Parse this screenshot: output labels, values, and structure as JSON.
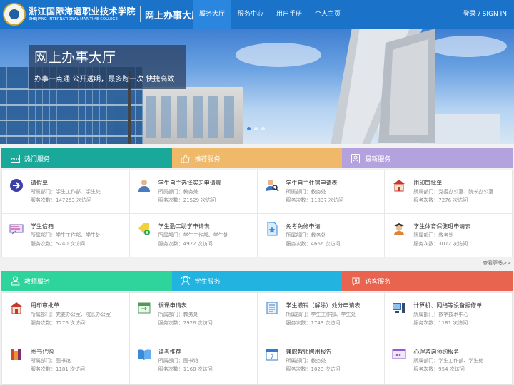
{
  "header": {
    "school_cn": "浙江国际海运职业技术学院",
    "school_en": "ZHEJIANG INTERNATIONAL MARITIME COLLEGE",
    "portal_title": "网上办事大厅",
    "nav": [
      "服务大厅",
      "服务中心",
      "用户手册",
      "个人主页"
    ],
    "login": "登录 / SIGN IN"
  },
  "banner": {
    "title": "网上办事大厅",
    "subtitle": "办事一点通 公开透明，最多跑一次 快捷高效",
    "slides": 3,
    "active_slide": 1
  },
  "section1": {
    "tabs": [
      {
        "label": "热门服务",
        "color": "#1aa89a",
        "icon": "hot-icon"
      },
      {
        "label": "推荐服务",
        "color": "#f0b96a",
        "icon": "thumb-up-icon"
      },
      {
        "label": "最新服务",
        "color": "#b4a2df",
        "icon": "new-badge-icon"
      }
    ],
    "cards": [
      {
        "title": "请假单",
        "dept": "所属部门：学生工作部、学生处",
        "count": "服务次数：147253 次访问",
        "icon": "arrow-circle-icon"
      },
      {
        "title": "学生自主选择实习申请表",
        "dept": "所属部门：教务处",
        "count": "服务次数：21529 次访问",
        "icon": "person-icon"
      },
      {
        "title": "学生自主住宿申请表",
        "dept": "所属部门：教务处",
        "count": "服务次数：11837 次访问",
        "icon": "person-search-icon"
      },
      {
        "title": "用印审批单",
        "dept": "所属部门：党委办公室、院长办公室",
        "count": "服务次数：7276 次访问",
        "icon": "building-icon"
      },
      {
        "title": "学生信箱",
        "dept": "所属部门：学生工作部、学生处",
        "count": "服务次数：5240 次访问",
        "icon": "mail-board-icon"
      },
      {
        "title": "学生勤工助学申请表",
        "dept": "所属部门：学生工作部、学生处",
        "count": "服务次数：4922 次访问",
        "icon": "tag-plus-icon"
      },
      {
        "title": "免考免修申请",
        "dept": "所属部门：教务处",
        "count": "服务次数：4666 次访问",
        "icon": "star-doc-icon"
      },
      {
        "title": "学生体育保健班申请表",
        "dept": "所属部门：教务处",
        "count": "服务次数：3072 次访问",
        "icon": "student-icon"
      }
    ],
    "more": "查看更多>>"
  },
  "section2": {
    "tabs": [
      {
        "label": "教师服务",
        "color": "#2fd39c",
        "icon": "teacher-icon"
      },
      {
        "label": "学生服务",
        "color": "#22b3e0",
        "icon": "student-service-icon"
      },
      {
        "label": "访客服务",
        "color": "#e8644f",
        "icon": "visitor-icon"
      }
    ],
    "cards": [
      {
        "title": "用印审批单",
        "dept": "所属部门：党委办公室、院长办公室",
        "count": "服务次数：7276 次访问",
        "icon": "building-icon"
      },
      {
        "title": "调课申请表",
        "dept": "所属部门：教务处",
        "count": "服务次数：2926 次访问",
        "icon": "calendar-swap-icon"
      },
      {
        "title": "学生撤销（解除）处分申请表",
        "dept": "所属部门：学生工作部、学生处",
        "count": "服务次数：1743 次访问",
        "icon": "document-icon"
      },
      {
        "title": "计算机、网络等设备报修单",
        "dept": "所属部门：数字技术中心",
        "count": "服务次数：1181 次访问",
        "icon": "computer-icon"
      },
      {
        "title": "图书代购",
        "dept": "所属部门：图书馆",
        "count": "服务次数：1181 次访问",
        "icon": "books-icon"
      },
      {
        "title": "读者推荐",
        "dept": "所属部门：图书馆",
        "count": "服务次数：1160 次访问",
        "icon": "open-book-icon"
      },
      {
        "title": "兼职教师聘用报告",
        "dept": "所属部门：教务处",
        "count": "服务次数：1023 次访问",
        "icon": "calendar-icon"
      },
      {
        "title": "心理咨询预约服务",
        "dept": "所属部门：学生工作部、学生处",
        "count": "服务次数：954 次访问",
        "icon": "chat-window-icon"
      }
    ]
  }
}
